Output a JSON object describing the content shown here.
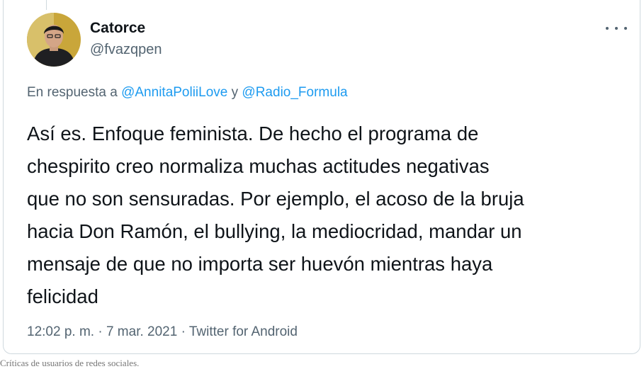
{
  "tweet": {
    "display_name": "Catorce",
    "handle": "@fvazqpen",
    "more_icon": "more-horizontal-icon",
    "reply": {
      "prefix": "En respuesta a",
      "mention1": "@AnnitaPoliiLove",
      "connector": "y",
      "mention2": "@Radio_Formula"
    },
    "text": "Así es. Enfoque feminista. De hecho el programa de\nchespirito creo normaliza muchas actitudes negativas\nque no son sensuradas. Por ejemplo, el acoso de la bruja\nhacia Don Ramón, el bullying, la mediocridad, mandar un\nmensaje de que no importa ser huevón mientras haya\nfelicidad",
    "time": "12:02 p. m.",
    "separator": "·",
    "date": "7 mar. 2021",
    "source": "Twitter for Android"
  },
  "caption": "Críticas de usuarios de redes sociales.",
  "colors": {
    "text": "#0f1419",
    "secondary": "#536471",
    "link": "#1d9bf0",
    "border": "#cfd9de"
  }
}
